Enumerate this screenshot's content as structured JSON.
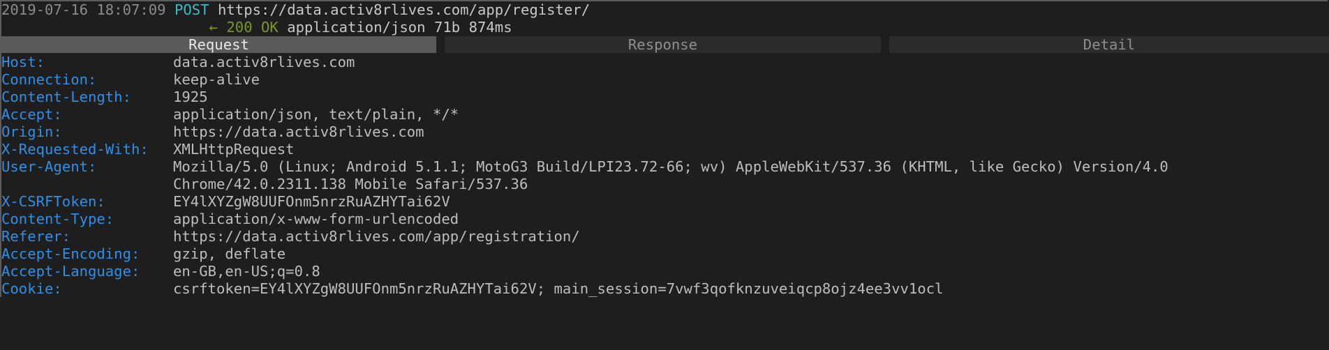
{
  "flow": {
    "timestamp": "2019-07-16 18:07:09",
    "method": "POST",
    "url": "https://data.activ8rlives.com/app/register/",
    "arrow": "←",
    "status": "200 OK",
    "content_type": "application/json",
    "size": "71b",
    "duration": "874ms"
  },
  "tabs": [
    {
      "label": "Request",
      "active": true
    },
    {
      "label": "Response",
      "active": false
    },
    {
      "label": "Detail",
      "active": false
    }
  ],
  "headers": [
    {
      "name": "Host:",
      "value": "data.activ8rlives.com"
    },
    {
      "name": "Connection:",
      "value": "keep-alive"
    },
    {
      "name": "Content-Length:",
      "value": "1925"
    },
    {
      "name": "Accept:",
      "value": "application/json, text/plain, */*"
    },
    {
      "name": "Origin:",
      "value": "https://data.activ8rlives.com"
    },
    {
      "name": "X-Requested-With:",
      "value": "XMLHttpRequest"
    },
    {
      "name": "User-Agent:",
      "value": "Mozilla/5.0 (Linux; Android 5.1.1; MotoG3 Build/LPI23.72-66; wv) AppleWebKit/537.36 (KHTML, like Gecko) Version/4.0",
      "value_cont": "Chrome/42.0.2311.138 Mobile Safari/537.36"
    },
    {
      "name": "X-CSRFToken:",
      "value": "EY4lXYZgW8UUFOnm5nrzRuAZHYTai62V"
    },
    {
      "name": "Content-Type:",
      "value": "application/x-www-form-urlencoded"
    },
    {
      "name": "Referer:",
      "value": "https://data.activ8rlives.com/app/registration/"
    },
    {
      "name": "Accept-Encoding:",
      "value": "gzip, deflate"
    },
    {
      "name": "Accept-Language:",
      "value": "en-GB,en-US;q=0.8"
    },
    {
      "name": "Cookie:",
      "value": "csrftoken=EY4lXYZgW8UUFOnm5nrzRuAZHYTai62V; main_session=7vwf3qofknzuveiqcp8ojz4ee3vv1ocl"
    }
  ],
  "colors": {
    "background": "#1e1e1e",
    "header_name": "#2f8fe8",
    "method": "#3fb9c5",
    "status": "#7a9a1e",
    "active_tab": "#5a5a5a"
  }
}
